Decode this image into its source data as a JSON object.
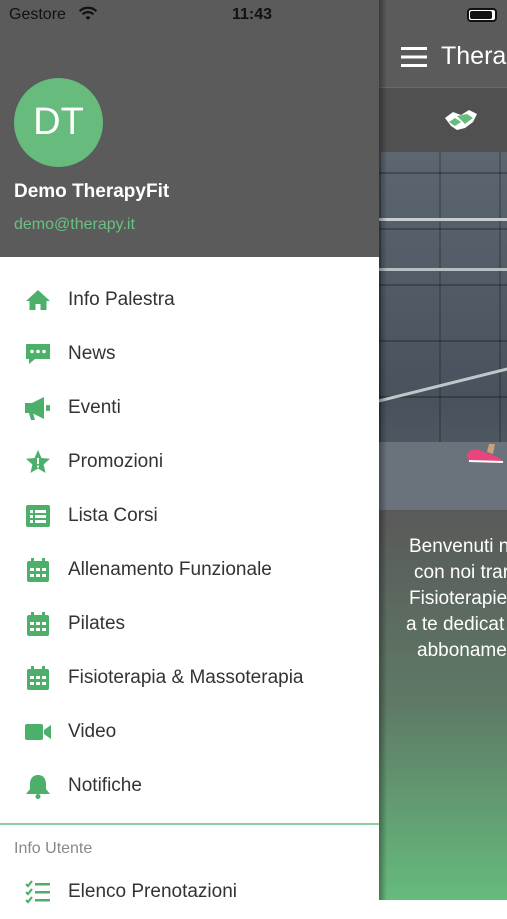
{
  "status_bar": {
    "carrier": "Gestore",
    "time": "11:43"
  },
  "drawer": {
    "avatar_initials": "DT",
    "user_name": "Demo TherapyFit",
    "user_email": "demo@therapy.it",
    "items": [
      {
        "label": "Info Palestra",
        "icon": "home-icon"
      },
      {
        "label": "News",
        "icon": "chat-icon"
      },
      {
        "label": "Eventi",
        "icon": "megaphone-icon"
      },
      {
        "label": "Promozioni",
        "icon": "star-icon"
      },
      {
        "label": "Lista Corsi",
        "icon": "list-icon"
      },
      {
        "label": "Allenamento Funzionale",
        "icon": "calendar-icon"
      },
      {
        "label": "Pilates",
        "icon": "calendar-icon"
      },
      {
        "label": "Fisioterapia & Massoterapia",
        "icon": "calendar-icon"
      },
      {
        "label": "Video",
        "icon": "video-camera-icon"
      },
      {
        "label": "Notifiche",
        "icon": "bell-icon"
      }
    ],
    "section_title": "Info Utente",
    "section_items": [
      {
        "label": "Elenco Prenotazioni",
        "icon": "checklist-icon"
      }
    ]
  },
  "main": {
    "title": "Therap",
    "welcome_lines": [
      "Benvenuti n",
      "con noi trar",
      "Fisioterapie",
      "a te dedicat",
      "abboname"
    ]
  },
  "colors": {
    "accent": "#4caf6a",
    "header_bg": "#5b5b5b",
    "avatar_bg": "#66bb7d"
  }
}
